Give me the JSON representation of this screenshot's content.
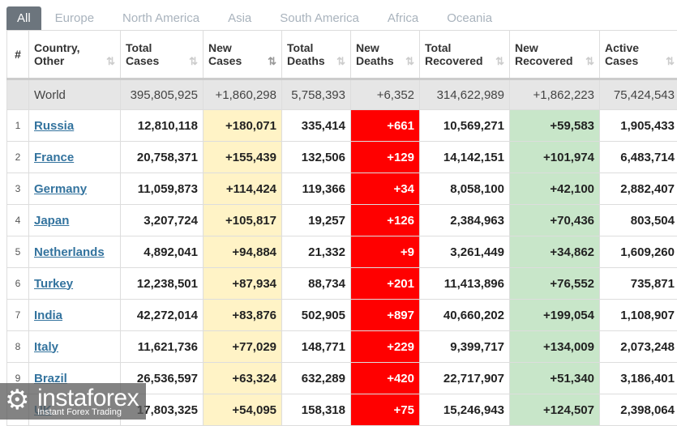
{
  "tabs": [
    "All",
    "Europe",
    "North America",
    "Asia",
    "South America",
    "Africa",
    "Oceania"
  ],
  "headers": [
    "#",
    "Country,\nOther",
    "Total\nCases",
    "New\nCases",
    "Total\nDeaths",
    "New\nDeaths",
    "Total\nRecovered",
    "New\nRecovered",
    "Active\nCases"
  ],
  "world": [
    "",
    "World",
    "395,805,925",
    "+1,860,298",
    "5,758,393",
    "+6,352",
    "314,622,989",
    "+1,862,223",
    "75,424,543"
  ],
  "rows": [
    [
      "1",
      "Russia",
      "12,810,118",
      "+180,071",
      "335,414",
      "+661",
      "10,569,271",
      "+59,583",
      "1,905,433"
    ],
    [
      "2",
      "France",
      "20,758,371",
      "+155,439",
      "132,506",
      "+129",
      "14,142,151",
      "+101,974",
      "6,483,714"
    ],
    [
      "3",
      "Germany",
      "11,059,873",
      "+114,424",
      "119,366",
      "+34",
      "8,058,100",
      "+42,100",
      "2,882,407"
    ],
    [
      "4",
      "Japan",
      "3,207,724",
      "+105,817",
      "19,257",
      "+126",
      "2,384,963",
      "+70,436",
      "803,504"
    ],
    [
      "5",
      "Netherlands",
      "4,892,041",
      "+94,884",
      "21,332",
      "+9",
      "3,261,449",
      "+34,862",
      "1,609,260"
    ],
    [
      "6",
      "Turkey",
      "12,238,501",
      "+87,934",
      "88,734",
      "+201",
      "11,413,896",
      "+76,552",
      "735,871"
    ],
    [
      "7",
      "India",
      "42,272,014",
      "+83,876",
      "502,905",
      "+897",
      "40,660,202",
      "+199,054",
      "1,108,907"
    ],
    [
      "8",
      "Italy",
      "11,621,736",
      "+77,029",
      "148,771",
      "+229",
      "9,399,717",
      "+134,009",
      "2,073,248"
    ],
    [
      "9",
      "Brazil",
      "26,536,597",
      "+63,324",
      "632,289",
      "+420",
      "22,717,907",
      "+51,340",
      "3,186,401"
    ],
    [
      "",
      "UK",
      "17,803,325",
      "+54,095",
      "158,318",
      "+75",
      "15,246,943",
      "+124,507",
      "2,398,064"
    ]
  ],
  "watermark": {
    "brand": "instaforex",
    "tagline": "Instant Forex Trading"
  },
  "colors": {
    "new_cases": "#fff3c6",
    "new_deaths": "#ff0000",
    "new_recovered": "#c8e6c9",
    "active_tab": "#6c757d",
    "link": "#33739e"
  }
}
